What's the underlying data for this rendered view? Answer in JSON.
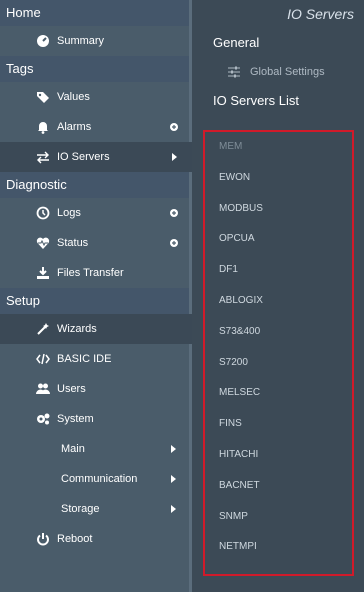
{
  "sidebar": {
    "sections": {
      "home": "Home",
      "tags": "Tags",
      "diagnostic": "Diagnostic",
      "setup": "Setup"
    },
    "items": {
      "summary": "Summary",
      "values": "Values",
      "alarms": "Alarms",
      "io_servers": "IO Servers",
      "logs": "Logs",
      "status": "Status",
      "files_transfer": "Files Transfer",
      "wizards": "Wizards",
      "basic_ide": "BASIC IDE",
      "users": "Users",
      "system": "System",
      "main": "Main",
      "communication": "Communication",
      "storage": "Storage",
      "reboot": "Reboot"
    }
  },
  "main": {
    "header_title": "IO Servers",
    "general_heading": "General",
    "global_settings": "Global Settings",
    "list_heading": "IO Servers List",
    "servers": [
      "MEM",
      "EWON",
      "MODBUS",
      "OPCUA",
      "DF1",
      "ABLOGIX",
      "S73&400",
      "S7200",
      "MELSEC",
      "FINS",
      "HITACHI",
      "BACNET",
      "SNMP",
      "NETMPI"
    ]
  },
  "colors": {
    "sidebar_bg": "#4a5c6a",
    "main_bg": "#3c4a56",
    "highlight_border": "#d11a2a"
  }
}
